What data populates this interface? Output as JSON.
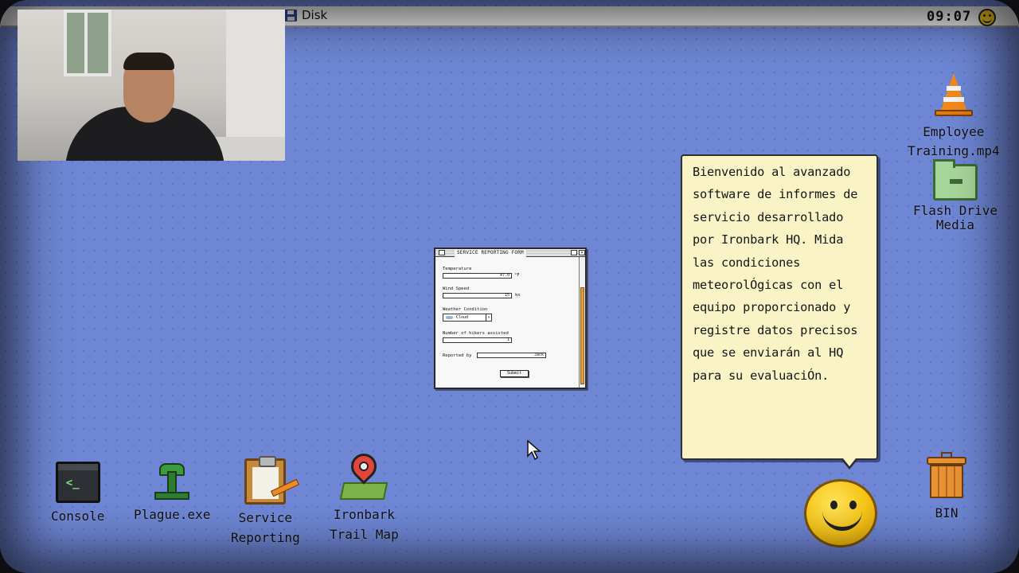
{
  "menubar": {
    "disk_label": "Disk",
    "clock": "09:07"
  },
  "desktop_icons": {
    "console": "Console",
    "plague": "Plague.exe",
    "service": "Service\nReporting",
    "trailmap": "Ironbark\nTrail Map",
    "training": "Employee\nTraining.mp4",
    "flash": "Flash Drive\nMedia",
    "bin": "BIN"
  },
  "form": {
    "title": "SERVICE REPORTING FORM",
    "temperature_label": "Temperature",
    "temperature_value": "47.0",
    "temperature_unit": "°F",
    "wind_label": "Wind Speed",
    "wind_value": "15",
    "wind_unit": "kn",
    "weather_label": "Weather Condition",
    "weather_value": "Cloud",
    "hikers_label": "Number of hikers assisted",
    "hikers_value": "1",
    "reported_label": "Reported by",
    "reported_value": "Jack",
    "submit_label": "Submit"
  },
  "bubble": {
    "text": "Bienvenido al avanzado software de informes de servicio desarrollado por Ironbark HQ. Mida las condiciones meteorolÓgicas con el equipo proporcionado y registre datos precisos que se enviarán al HQ para su evaluaciÓn."
  },
  "colors": {
    "desktop": "#6e86d4",
    "bubble_bg": "#f9f3c6",
    "scroll_thumb": "#e39c3a"
  }
}
